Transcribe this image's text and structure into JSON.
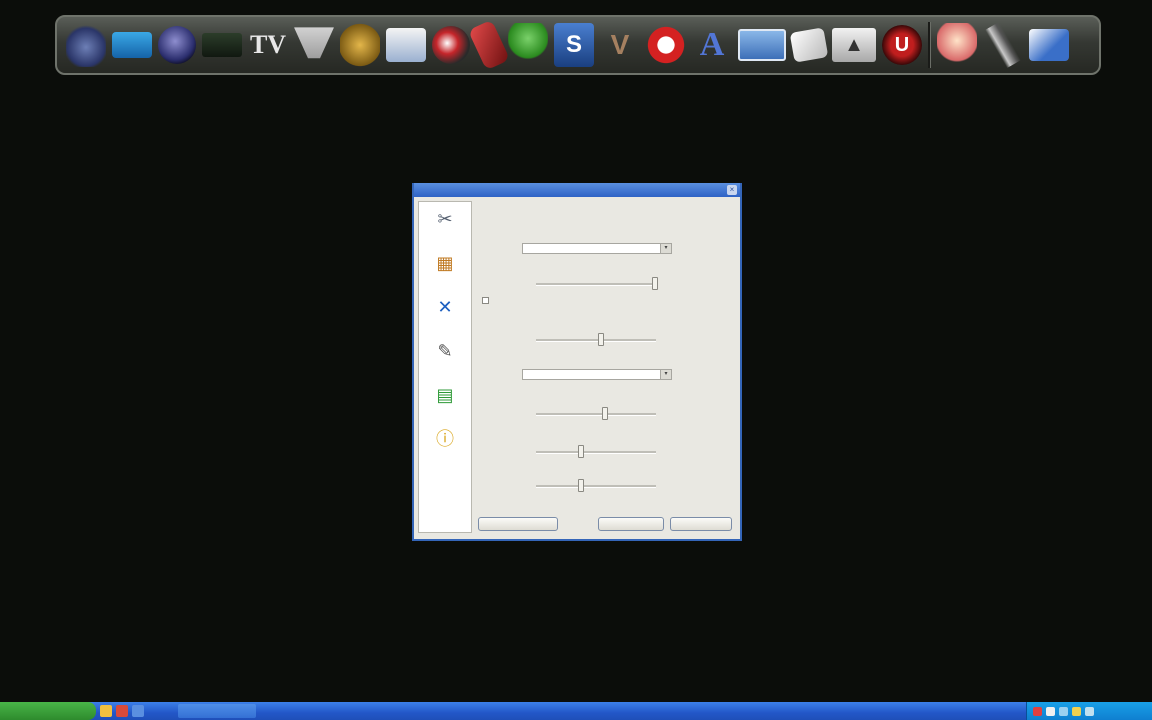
{
  "dock": {
    "icons": [
      {
        "name": "guitar-icon",
        "glyph": ""
      },
      {
        "name": "blue-app-icon",
        "glyph": ""
      },
      {
        "name": "globe-icon",
        "glyph": ""
      },
      {
        "name": "dark-app-icon",
        "glyph": ""
      },
      {
        "name": "tv-icon",
        "glyph": "TV"
      },
      {
        "name": "funnel-icon",
        "glyph": ""
      },
      {
        "name": "truck-icon",
        "glyph": ""
      },
      {
        "name": "box-icon",
        "glyph": ""
      },
      {
        "name": "helmet-icon",
        "glyph": ""
      },
      {
        "name": "phone-icon",
        "glyph": ""
      },
      {
        "name": "msn-icon",
        "glyph": ""
      },
      {
        "name": "s-app-icon",
        "glyph": "S"
      },
      {
        "name": "v-app-icon",
        "glyph": "V"
      },
      {
        "name": "ghost-icon",
        "glyph": ""
      },
      {
        "name": "a-app-icon",
        "glyph": "A"
      },
      {
        "name": "window-icon",
        "glyph": ""
      },
      {
        "name": "paper-icon",
        "glyph": ""
      },
      {
        "name": "triangle-app-icon",
        "glyph": "▲"
      },
      {
        "name": "u-app-icon",
        "glyph": "U"
      },
      {
        "name": "bell-icon",
        "glyph": ""
      },
      {
        "name": "pen-icon",
        "glyph": ""
      },
      {
        "name": "drive-icon",
        "glyph": ""
      }
    ]
  },
  "dialog": {
    "close_glyph": "×",
    "sidebar": [
      {
        "name": "sidebar-item-1",
        "icon": "tools-icon",
        "glyph": "✂",
        "color": "#556070"
      },
      {
        "name": "sidebar-item-2",
        "icon": "box-icon",
        "glyph": "▦",
        "color": "#c07a22"
      },
      {
        "name": "sidebar-item-3",
        "icon": "cross-icon",
        "glyph": "✕",
        "color": "#1d5fc0"
      },
      {
        "name": "sidebar-item-4",
        "icon": "pen-icon",
        "glyph": "✎",
        "color": "#555"
      },
      {
        "name": "sidebar-item-5",
        "icon": "spreadsheet-icon",
        "glyph": "▤",
        "color": "#2f9a38"
      },
      {
        "name": "sidebar-item-6",
        "icon": "info-icon",
        "glyph": "ⓘ",
        "color": "#d8a418"
      }
    ]
  },
  "taskbar": {
    "start_label": "",
    "task_label": "",
    "clock": ""
  },
  "colors": {
    "dock_bg": "#353833",
    "desktop_bg": "#0b0d0a",
    "dialog_border": "#3465b8",
    "taskbar_blue": "#2357c8",
    "start_green": "#2e8b2d"
  }
}
